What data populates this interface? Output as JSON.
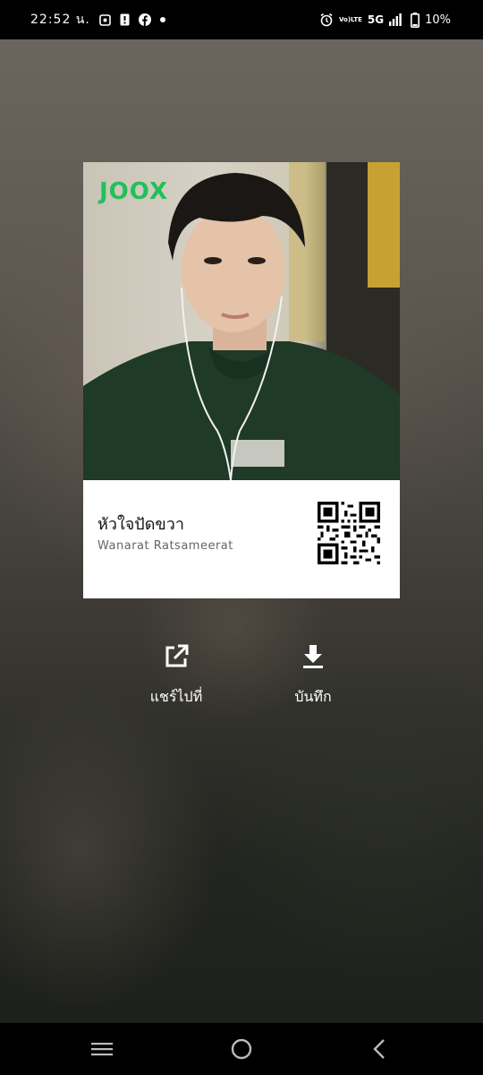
{
  "status_bar": {
    "time": "22:52 น.",
    "battery": "10%",
    "network": "5G",
    "volte_top": "Vo)",
    "volte_bottom": "LTE"
  },
  "card": {
    "logo_text": "JOOX",
    "song_title": "หัวใจปัดขวา",
    "artist": "Wanarat Ratsameerat",
    "logo_color": "#22c05a"
  },
  "actions": {
    "share_label": "แชร์ไปที่",
    "save_label": "บันทึก"
  },
  "icons": {
    "share": "external-link-icon",
    "save": "download-icon",
    "recents": "recents-icon",
    "home": "home-icon",
    "back": "back-icon"
  }
}
